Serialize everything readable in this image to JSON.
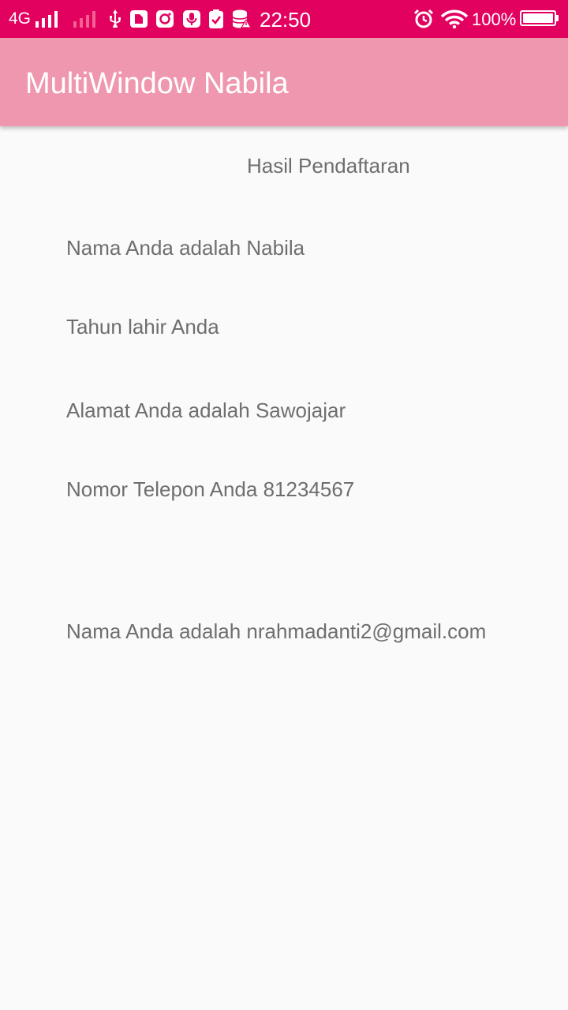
{
  "status_bar": {
    "network": "4G",
    "time": "22:50",
    "battery_percent_text": "100%",
    "battery_level": 1.0,
    "icons": [
      "signal-icon",
      "signal-weak-icon",
      "usb-icon",
      "sim-icon",
      "instagram-icon",
      "mic-icon",
      "clipboard-check-icon",
      "storage-icon",
      "alarm-icon",
      "wifi-icon",
      "battery-icon"
    ]
  },
  "app_bar": {
    "title": "MultiWindow Nabila"
  },
  "content": {
    "heading": "Hasil Pendaftaran",
    "lines": [
      "Nama Anda adalah Nabila",
      "Tahun lahir Anda",
      "Alamat Anda adalah Sawojajar",
      "Nomor Telepon Anda 81234567",
      "Nama Anda adalah nrahmadanti2@gmail.com"
    ]
  },
  "colors": {
    "status_bar": "#e3015f",
    "app_bar": "#ef97ae",
    "background": "#fafafa",
    "text": "#6e6e6e"
  }
}
